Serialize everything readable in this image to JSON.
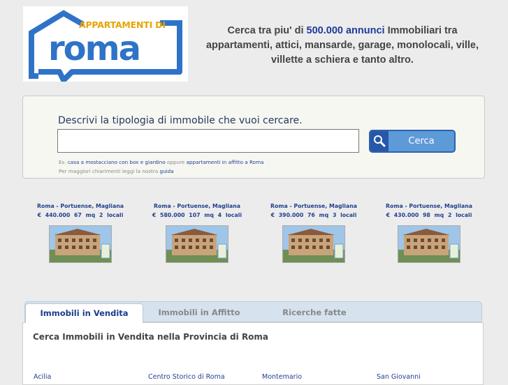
{
  "logo": {
    "top_text": "APPARTAMENTI DI",
    "word": "roma",
    "colors": {
      "house": "#2f73c8",
      "top_text": "#e8a400"
    }
  },
  "tagline": {
    "before": "Cerca tra piu' di ",
    "highlight": "500.000 annunci",
    "after": " Immobiliari tra appartamenti, attici, mansarde, garage, monolocali, ville, villette a schiera e tanto altro."
  },
  "search": {
    "title": "Descrivi la tipologia di immobile che vuoi cercare.",
    "input_value": "",
    "button_label": "Cerca",
    "hint_prefix": "Es. ",
    "hint_example1": "casa a mostacciano con box e giardino",
    "hint_mid": " oppure ",
    "hint_example2": "appartamenti in affitto a Roma",
    "hint2_prefix": "Per maggiori chiarimenti leggi la nostra ",
    "hint2_link": "guida"
  },
  "listings": [
    {
      "location": "Roma - Portuense, Magliana",
      "price": "€ 440.000",
      "size": "67 mq",
      "rooms": "2 locali"
    },
    {
      "location": "Roma - Portuense, Magliana",
      "price": "€ 580.000",
      "size": "107 mq",
      "rooms": "4 locali"
    },
    {
      "location": "Roma - Portuense, Magliana",
      "price": "€ 390.000",
      "size": "76 mq",
      "rooms": "3 locali"
    },
    {
      "location": "Roma - Portuense, Magliana",
      "price": "€ 430.000",
      "size": "98 mq",
      "rooms": "2 locali"
    }
  ],
  "tabs": [
    {
      "label": "Immobili in Vendita",
      "active": true
    },
    {
      "label": "Immobili in Affitto",
      "active": false
    },
    {
      "label": "Ricerche fatte",
      "active": false
    }
  ],
  "panel": {
    "title": "Cerca Immobili in Vendita nella Provincia di Roma",
    "cities": [
      "Acilia",
      "Centro Storico di Roma",
      "Montemario",
      "San Giovanni"
    ]
  },
  "colors": {
    "page_bg": "#ececec",
    "accent_blue": "#23418f",
    "button_blue": "#5d9ad8"
  }
}
